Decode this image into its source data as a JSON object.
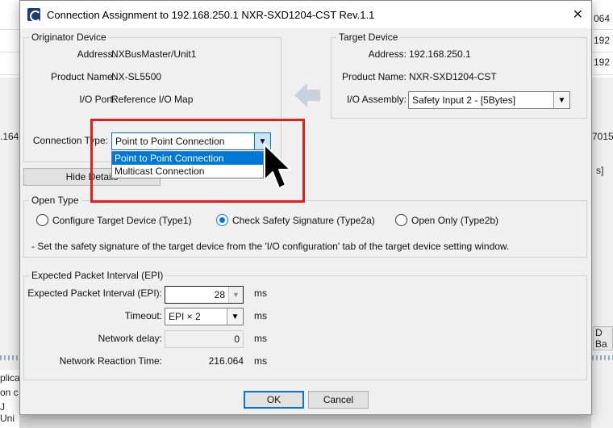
{
  "background": {
    "right_values": [
      "064",
      "192",
      "192"
    ],
    "left_frag": ".164",
    "right_frag": "7015",
    "right_bracket": "s]",
    "right_btn": "D Ba",
    "bottom_lines": [
      "plica",
      "on c",
      "J Uni"
    ]
  },
  "dialog": {
    "title": "Connection Assignment to 192.168.250.1 NXR-SXD1204-CST Rev.1.1",
    "close_glyph": "✕"
  },
  "originator": {
    "legend": "Originator Device",
    "address_label": "Address",
    "address_value": "NXBusMaster/Unit1",
    "product_label": "Product Name",
    "product_value": "NX-SL5500",
    "io_port_label": "I/O Port",
    "io_port_value": "Reference I/O Map",
    "conn_type_label": "Connection Type",
    "conn_type_value": "Point to Point Connection",
    "hide_details_button": "Hide Details"
  },
  "dropdown": {
    "options": [
      "Point to Point Connection",
      "Multicast Connection"
    ],
    "selected_index": 0
  },
  "target": {
    "legend": "Target Device",
    "address_label": "Address",
    "address_value": "192.168.250.1",
    "product_label": "Product Name",
    "product_value": "NXR-SXD1204-CST",
    "io_assembly_label": "I/O Assembly",
    "io_assembly_value": "Safety Input 2 - [5Bytes]"
  },
  "open_type": {
    "legend": "Open Type",
    "options": [
      {
        "label": "Configure Target Device (Type1)",
        "checked": false
      },
      {
        "label": "Check Safety Signature (Type2a)",
        "checked": true
      },
      {
        "label": "Open Only (Type2b)",
        "checked": false
      }
    ],
    "note": "- Set the safety signature of the target device from the 'I/O configuration' tab of the target device setting window."
  },
  "epi": {
    "legend": "Expected Packet Interval (EPI)",
    "epi_label": "Expected Packet Interval (EPI)",
    "epi_value": "28",
    "timeout_label": "Timeout",
    "timeout_value": "EPI × 2",
    "network_delay_label": "Network delay",
    "network_delay_value": "0",
    "reaction_label": "Network Reaction Time",
    "reaction_value": "216.064",
    "unit": "ms",
    "colon": ":"
  },
  "footer": {
    "ok": "OK",
    "cancel": "Cancel"
  },
  "icons": {
    "transfer_arrow": "left-arrow-icon",
    "combo_arrow": "▼",
    "spin_arrow": "▼"
  },
  "colors": {
    "highlight": "#e0211b",
    "selection": "#0078d7"
  }
}
